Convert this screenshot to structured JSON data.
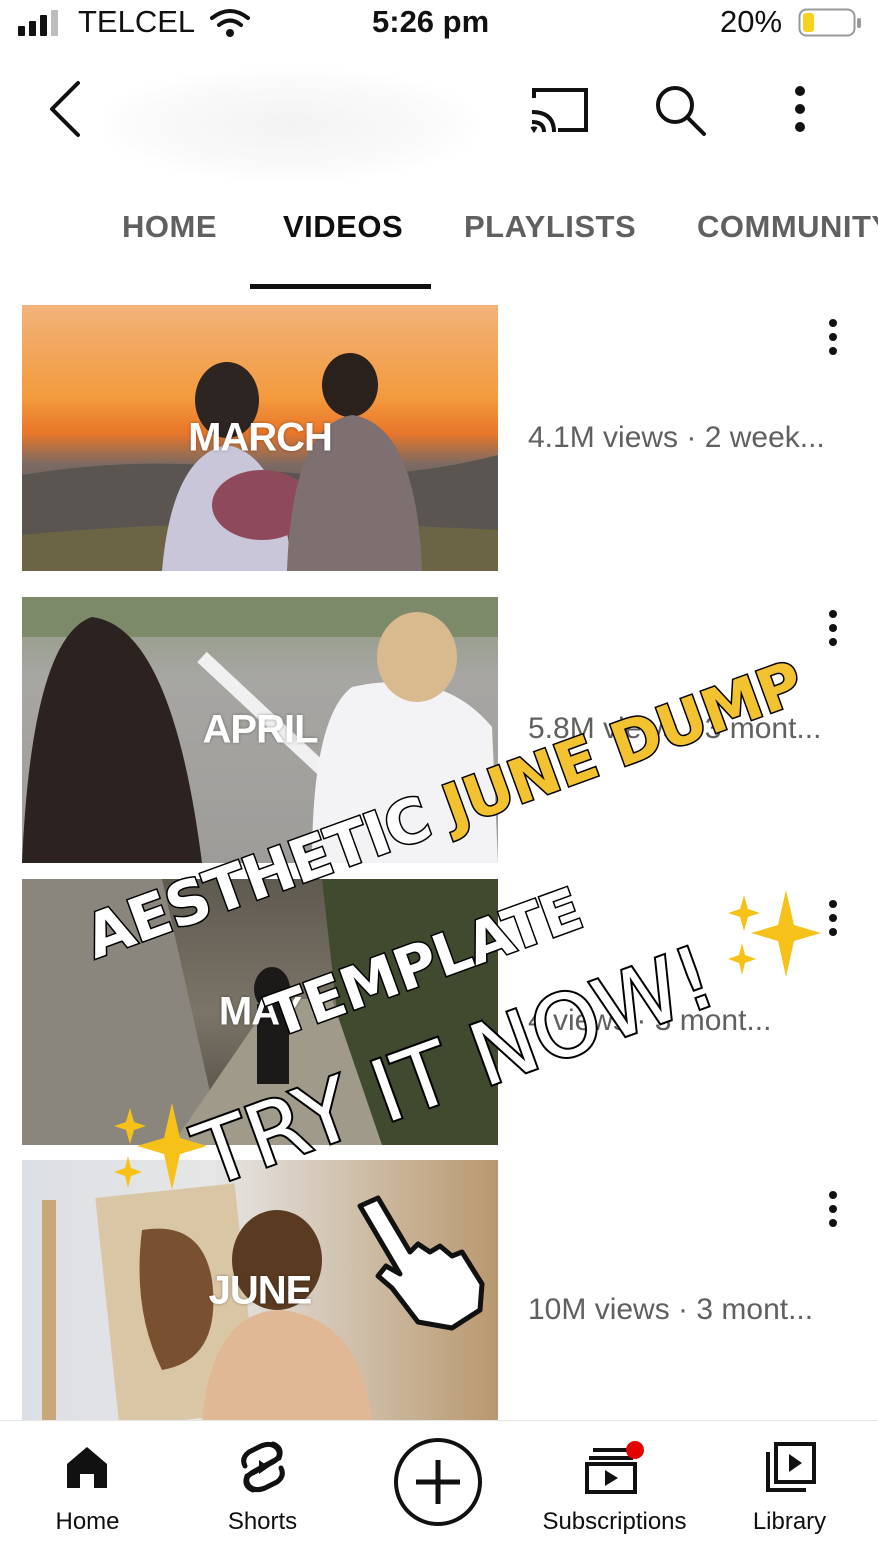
{
  "status_bar": {
    "carrier": "TELCEL",
    "time": "5:26 pm",
    "battery": "20%"
  },
  "header": {
    "icons": [
      "back-arrow-icon",
      "cast-icon",
      "search-icon",
      "more-vert-icon"
    ]
  },
  "tabs": [
    {
      "label": "HOME",
      "active": false
    },
    {
      "label": "VIDEOS",
      "active": true
    },
    {
      "label": "PLAYLISTS",
      "active": false
    },
    {
      "label": "COMMUNITY",
      "active": false
    }
  ],
  "videos": [
    {
      "thumb_text": "MARCH",
      "meta": "4.1M views · 2 week..."
    },
    {
      "thumb_text": "APRIL",
      "meta": "5.8M views · 3 mont..."
    },
    {
      "thumb_text": "MAY",
      "meta": "4 views · 3 mont..."
    },
    {
      "thumb_text": "JUNE",
      "meta": "10M views · 3 mont..."
    }
  ],
  "overlay": {
    "line1_a": "AESTHETIC ",
    "line1_b": "JUNE DUMP",
    "line2": "TEMPLATE",
    "line3": "TRY IT NOW!"
  },
  "bottom_nav": [
    {
      "label": "Home",
      "icon": "home-icon"
    },
    {
      "label": "Shorts",
      "icon": "shorts-icon"
    },
    {
      "label": "",
      "icon": "create-plus-icon"
    },
    {
      "label": "Subscriptions",
      "icon": "subscriptions-icon"
    },
    {
      "label": "Library",
      "icon": "library-icon"
    }
  ],
  "colors": {
    "highlight": "#f2c230",
    "notification_dot": "#e30000",
    "battery_fill": "#f7d21c"
  }
}
